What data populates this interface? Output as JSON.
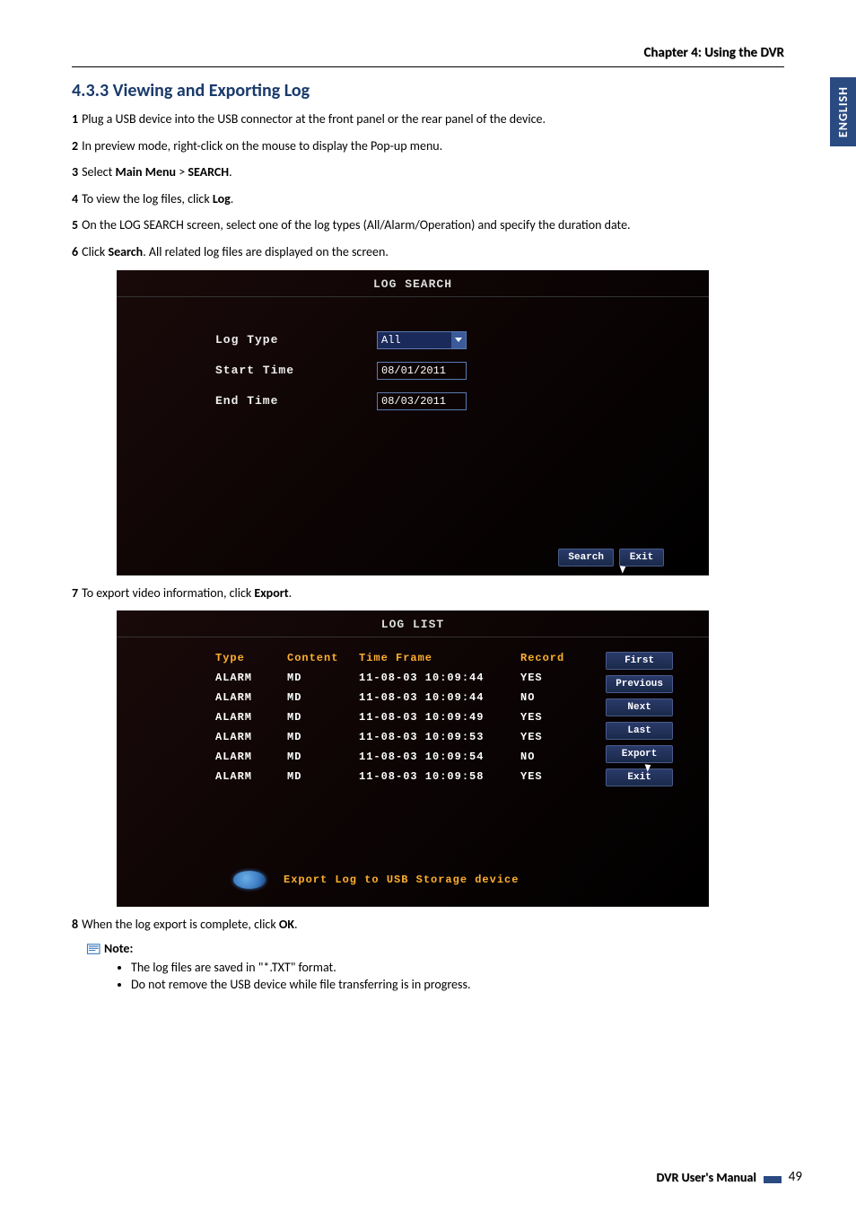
{
  "header": {
    "chapter": "Chapter 4: Using the DVR"
  },
  "sidetab": "ENGLISH",
  "section": {
    "title": "4.3.3 Viewing and Exporting Log"
  },
  "steps": {
    "s1": {
      "n": "1",
      "text": "Plug a USB device into the USB connector at the front panel or the rear panel of the device."
    },
    "s2": {
      "n": "2",
      "text": "In preview mode, right-click on the mouse to display the Pop-up menu."
    },
    "s3": {
      "n": "3",
      "pre": "Select ",
      "b1": "Main Menu",
      "mid": " > ",
      "b2": "SEARCH",
      "post": "."
    },
    "s4": {
      "n": "4",
      "pre": "To view the log files, click ",
      "b1": "Log",
      "post": "."
    },
    "s5": {
      "n": "5",
      "text": "On the LOG SEARCH screen, select one of the log types (All/Alarm/Operation) and specify the duration date."
    },
    "s6": {
      "n": "6",
      "pre": "Click ",
      "b1": "Search",
      "post": ". All related log files are displayed on the screen."
    },
    "s7": {
      "n": "7",
      "pre": "To export video information, click ",
      "b1": "Export",
      "post": "."
    },
    "s8": {
      "n": "8",
      "pre": "When the log export is complete, click ",
      "b1": "OK",
      "post": "."
    }
  },
  "screen1": {
    "title": "LOG SEARCH",
    "labels": {
      "logtype": "Log Type",
      "start": "Start Time",
      "end": "End Time"
    },
    "values": {
      "logtype": "All",
      "start": "08/01/2011",
      "end": "08/03/2011"
    },
    "buttons": {
      "search": "Search",
      "exit": "Exit"
    }
  },
  "screen2": {
    "title": "LOG LIST",
    "headers": {
      "type": "Type",
      "content": "Content",
      "time": "Time Frame",
      "record": "Record"
    },
    "rows": [
      {
        "type": "ALARM",
        "content": "MD",
        "time": "11-08-03 10:09:44",
        "record": "YES"
      },
      {
        "type": "ALARM",
        "content": "MD",
        "time": "11-08-03 10:09:44",
        "record": "NO"
      },
      {
        "type": "ALARM",
        "content": "MD",
        "time": "11-08-03 10:09:49",
        "record": "YES"
      },
      {
        "type": "ALARM",
        "content": "MD",
        "time": "11-08-03 10:09:53",
        "record": "YES"
      },
      {
        "type": "ALARM",
        "content": "MD",
        "time": "11-08-03 10:09:54",
        "record": "NO"
      },
      {
        "type": "ALARM",
        "content": "MD",
        "time": "11-08-03 10:09:58",
        "record": "YES"
      }
    ],
    "sidebtns": {
      "first": "First",
      "prev": "Previous",
      "next": "Next",
      "last": "Last",
      "export": "Export",
      "exit": "Exit"
    },
    "exportbar": "Export Log to USB Storage device"
  },
  "note": {
    "label": "Note:",
    "items": [
      "The log files are saved in \"*.TXT\" format.",
      "Do not remove the USB device while file transferring is in progress."
    ]
  },
  "footer": {
    "manual": "DVR User's Manual",
    "page": "49"
  }
}
